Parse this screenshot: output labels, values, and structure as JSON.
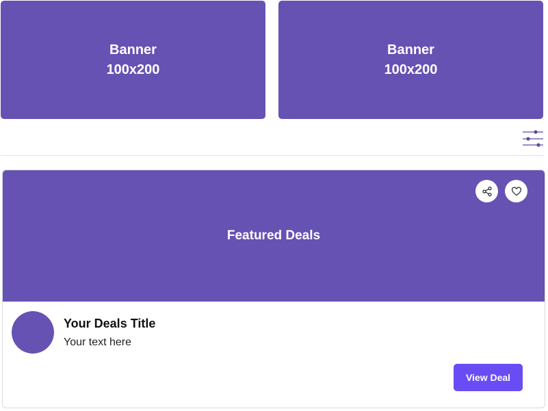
{
  "banners": [
    {
      "line1": "Banner",
      "line2": "100x200"
    },
    {
      "line1": "Banner",
      "line2": "100x200"
    }
  ],
  "toolbar": {
    "filter_icon": "sliders-icon"
  },
  "featured": {
    "hero_label": "Featured Deals",
    "share_icon": "share-icon",
    "heart_icon": "heart-icon",
    "deal_title": "Your Deals Title",
    "deal_text": "Your text here",
    "button_label": "View Deal"
  },
  "colors": {
    "brand_purple": "#6652b3",
    "button_purple": "#6a4cf5",
    "divider": "#e2e2e6"
  }
}
